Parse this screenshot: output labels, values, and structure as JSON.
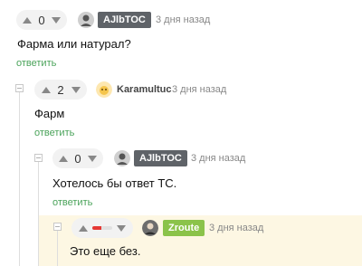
{
  "comments": [
    {
      "score": "0",
      "username": "AJlbTOC",
      "time": "3 дня назад",
      "text": "Фарма или натурал?",
      "reply_label": "ответить"
    },
    {
      "score": "2",
      "username": "Karamultuc",
      "time": "3 дня назад",
      "text": "Фарм",
      "reply_label": "ответить"
    },
    {
      "score": "0",
      "username": "AJlbTOC",
      "time": "3 дня назад",
      "text": "Хотелось бы ответ ТС.",
      "reply_label": "ответить"
    },
    {
      "username": "Zroute",
      "time": "3 дня назад",
      "text": "Это еще без."
    }
  ],
  "colors": {
    "badge_dark": "#5f6368",
    "badge_green": "#8bc34a",
    "reply_green": "#4aa35a",
    "highlight_bg": "#fdf7e3",
    "rating_bar": "#e53935"
  }
}
